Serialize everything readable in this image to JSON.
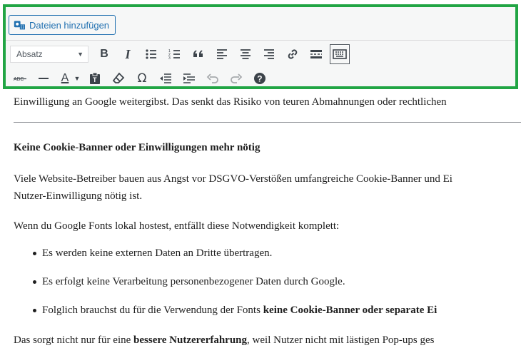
{
  "media_button": {
    "label": "Dateien hinzufügen",
    "icon": "add-media-icon"
  },
  "format_select": {
    "value": "Absatz"
  },
  "toolbar": {
    "row1": [
      "bold-icon",
      "italic-icon",
      "bulleted-list-icon",
      "numbered-list-icon",
      "blockquote-icon",
      "align-left-icon",
      "align-center-icon",
      "align-right-icon",
      "insert-link-icon",
      "read-more-icon",
      "toolbar-toggle-icon"
    ],
    "row2": [
      "strikethrough-icon",
      "horizontal-line-icon",
      "text-color-icon",
      "paste-as-text-icon",
      "clear-formatting-icon",
      "special-character-icon",
      "outdent-icon",
      "indent-icon",
      "undo-icon",
      "redo-icon",
      "help-icon"
    ],
    "bold_glyph": "B",
    "italic_glyph": "I",
    "omega_glyph": "Ω",
    "textcolor_glyph": "A",
    "help_glyph": "?"
  },
  "colors": {
    "highlight_border": "#21a544",
    "accent": "#2271b1"
  },
  "content": {
    "p0": "Einwilligung an Google weitergibst. Das senkt das Risiko von teuren Abmahnungen oder rechtlichen",
    "heading": "Keine Cookie-Banner oder Einwilligungen mehr nötig",
    "p1_line1": "Viele Website-Betreiber bauen aus Angst vor DSGVO-Verstößen umfangreiche Cookie-Banner und Ei",
    "p1_line2": "Nutzer-Einwilligung nötig ist.",
    "p2": "Wenn du Google Fonts lokal hostest, entfällt diese Notwendigkeit komplett:",
    "li1": "Es werden keine externen Daten an Dritte übertragen.",
    "li2": "Es erfolgt keine Verarbeitung personenbezogener Daten durch Google.",
    "li3_pre": "Folglich brauchst du für die Verwendung der Fonts ",
    "li3_bold": "keine Cookie-Banner oder separate Ei",
    "p3_pre": "Das sorgt nicht nur für eine ",
    "p3_bold": "bessere Nutzererfahrung",
    "p3_post": ", weil Nutzer nicht mit lästigen Pop-ups ges"
  }
}
